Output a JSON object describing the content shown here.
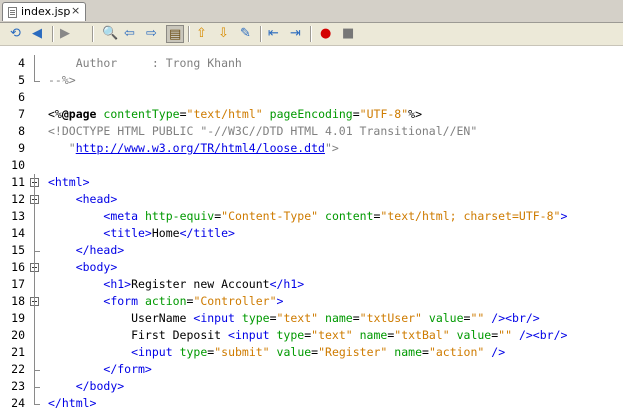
{
  "tab": {
    "title": "index.jsp",
    "close": "×"
  },
  "toolbar": {
    "buttons": [
      {
        "name": "last-edit-icon",
        "icon": "⟲"
      },
      {
        "name": "back-icon",
        "icon": "◀"
      },
      {
        "name": "forward-icon",
        "icon": "▶"
      },
      {
        "name": "find-icon",
        "icon": "🔍"
      },
      {
        "name": "find-previous-icon",
        "icon": "⇦"
      },
      {
        "name": "find-next-icon",
        "icon": "⇨"
      },
      {
        "name": "toggle-highlight-icon",
        "icon": "▤"
      },
      {
        "name": "previous-bookmark-icon",
        "icon": "⇧"
      },
      {
        "name": "next-bookmark-icon",
        "icon": "⇩"
      },
      {
        "name": "toggle-bookmark-icon",
        "icon": "✎"
      },
      {
        "name": "shift-left-icon",
        "icon": "⇤"
      },
      {
        "name": "shift-right-icon",
        "icon": "⇥"
      },
      {
        "name": "record-macro-icon",
        "icon": "●"
      },
      {
        "name": "stop-macro-icon",
        "icon": "■"
      }
    ]
  },
  "lines": [
    {
      "num": "4",
      "parts": [
        {
          "c": "cmt",
          "t": "    Author     : Trong Khanh"
        }
      ]
    },
    {
      "num": "5",
      "parts": [
        {
          "c": "cmt",
          "t": "--%>"
        }
      ]
    },
    {
      "num": "6",
      "parts": []
    },
    {
      "num": "7",
      "parts": [
        {
          "c": "txt",
          "t": "<%"
        },
        {
          "c": "dir",
          "t": "@page"
        },
        {
          "c": "txt",
          "t": " "
        },
        {
          "c": "attr",
          "t": "contentType"
        },
        {
          "c": "txt",
          "t": "="
        },
        {
          "c": "str",
          "t": "\"text/html\""
        },
        {
          "c": "txt",
          "t": " "
        },
        {
          "c": "attr",
          "t": "pageEncoding"
        },
        {
          "c": "txt",
          "t": "="
        },
        {
          "c": "str",
          "t": "\"UTF-8\""
        },
        {
          "c": "txt",
          "t": "%>"
        }
      ]
    },
    {
      "num": "8",
      "parts": [
        {
          "c": "doct",
          "t": "<!DOCTYPE HTML PUBLIC \"-//W3C//DTD HTML 4.01 Transitional//EN\""
        }
      ]
    },
    {
      "num": "9",
      "parts": [
        {
          "c": "doct",
          "t": "   \""
        },
        {
          "c": "link",
          "t": "http://www.w3.org/TR/html4/loose.dtd"
        },
        {
          "c": "doct",
          "t": "\">"
        }
      ]
    },
    {
      "num": "10",
      "parts": []
    },
    {
      "num": "11",
      "parts": [
        {
          "c": "tag",
          "t": "<html>"
        }
      ]
    },
    {
      "num": "12",
      "parts": [
        {
          "c": "txt",
          "t": "    "
        },
        {
          "c": "tag",
          "t": "<head>"
        }
      ]
    },
    {
      "num": "13",
      "parts": [
        {
          "c": "txt",
          "t": "        "
        },
        {
          "c": "tag",
          "t": "<meta"
        },
        {
          "c": "txt",
          "t": " "
        },
        {
          "c": "attr",
          "t": "http-equiv"
        },
        {
          "c": "txt",
          "t": "="
        },
        {
          "c": "str",
          "t": "\"Content-Type\""
        },
        {
          "c": "txt",
          "t": " "
        },
        {
          "c": "attr",
          "t": "content"
        },
        {
          "c": "txt",
          "t": "="
        },
        {
          "c": "str",
          "t": "\"text/html; charset=UTF-8\""
        },
        {
          "c": "tag",
          "t": ">"
        }
      ]
    },
    {
      "num": "14",
      "parts": [
        {
          "c": "txt",
          "t": "        "
        },
        {
          "c": "tag",
          "t": "<title>"
        },
        {
          "c": "txt",
          "t": "Home"
        },
        {
          "c": "tag",
          "t": "</title>"
        }
      ]
    },
    {
      "num": "15",
      "parts": [
        {
          "c": "txt",
          "t": "    "
        },
        {
          "c": "tag",
          "t": "</head>"
        }
      ]
    },
    {
      "num": "16",
      "parts": [
        {
          "c": "txt",
          "t": "    "
        },
        {
          "c": "tag",
          "t": "<body>"
        }
      ]
    },
    {
      "num": "17",
      "parts": [
        {
          "c": "txt",
          "t": "        "
        },
        {
          "c": "tag",
          "t": "<h1>"
        },
        {
          "c": "txt",
          "t": "Register new Account"
        },
        {
          "c": "tag",
          "t": "</h1>"
        }
      ]
    },
    {
      "num": "18",
      "parts": [
        {
          "c": "txt",
          "t": "        "
        },
        {
          "c": "tag",
          "t": "<form"
        },
        {
          "c": "txt",
          "t": " "
        },
        {
          "c": "attr",
          "t": "action"
        },
        {
          "c": "txt",
          "t": "="
        },
        {
          "c": "str",
          "t": "\"Controller\""
        },
        {
          "c": "tag",
          "t": ">"
        }
      ]
    },
    {
      "num": "19",
      "parts": [
        {
          "c": "txt",
          "t": "            UserName "
        },
        {
          "c": "tag",
          "t": "<input"
        },
        {
          "c": "txt",
          "t": " "
        },
        {
          "c": "attr",
          "t": "type"
        },
        {
          "c": "txt",
          "t": "="
        },
        {
          "c": "str",
          "t": "\"text\""
        },
        {
          "c": "txt",
          "t": " "
        },
        {
          "c": "attr",
          "t": "name"
        },
        {
          "c": "txt",
          "t": "="
        },
        {
          "c": "str",
          "t": "\"txtUser\""
        },
        {
          "c": "txt",
          "t": " "
        },
        {
          "c": "attr",
          "t": "value"
        },
        {
          "c": "txt",
          "t": "="
        },
        {
          "c": "str",
          "t": "\"\""
        },
        {
          "c": "txt",
          "t": " "
        },
        {
          "c": "tag",
          "t": "/><br/>"
        }
      ]
    },
    {
      "num": "20",
      "parts": [
        {
          "c": "txt",
          "t": "            First Deposit "
        },
        {
          "c": "tag",
          "t": "<input"
        },
        {
          "c": "txt",
          "t": " "
        },
        {
          "c": "attr",
          "t": "type"
        },
        {
          "c": "txt",
          "t": "="
        },
        {
          "c": "str",
          "t": "\"text\""
        },
        {
          "c": "txt",
          "t": " "
        },
        {
          "c": "attr",
          "t": "name"
        },
        {
          "c": "txt",
          "t": "="
        },
        {
          "c": "str",
          "t": "\"txtBal\""
        },
        {
          "c": "txt",
          "t": " "
        },
        {
          "c": "attr",
          "t": "value"
        },
        {
          "c": "txt",
          "t": "="
        },
        {
          "c": "str",
          "t": "\"\""
        },
        {
          "c": "txt",
          "t": " "
        },
        {
          "c": "tag",
          "t": "/><br/>"
        }
      ]
    },
    {
      "num": "21",
      "parts": [
        {
          "c": "txt",
          "t": "            "
        },
        {
          "c": "tag",
          "t": "<input"
        },
        {
          "c": "txt",
          "t": " "
        },
        {
          "c": "attr",
          "t": "type"
        },
        {
          "c": "txt",
          "t": "="
        },
        {
          "c": "str",
          "t": "\"submit\""
        },
        {
          "c": "txt",
          "t": " "
        },
        {
          "c": "attr",
          "t": "value"
        },
        {
          "c": "txt",
          "t": "="
        },
        {
          "c": "str",
          "t": "\"Register\""
        },
        {
          "c": "txt",
          "t": " "
        },
        {
          "c": "attr",
          "t": "name"
        },
        {
          "c": "txt",
          "t": "="
        },
        {
          "c": "str",
          "t": "\"action\""
        },
        {
          "c": "txt",
          "t": " "
        },
        {
          "c": "tag",
          "t": "/>"
        }
      ]
    },
    {
      "num": "22",
      "parts": [
        {
          "c": "txt",
          "t": "        "
        },
        {
          "c": "tag",
          "t": "</form>"
        }
      ]
    },
    {
      "num": "23",
      "parts": [
        {
          "c": "txt",
          "t": "    "
        },
        {
          "c": "tag",
          "t": "</body>"
        }
      ]
    },
    {
      "num": "24",
      "parts": [
        {
          "c": "tag",
          "t": "</html>"
        }
      ]
    }
  ]
}
